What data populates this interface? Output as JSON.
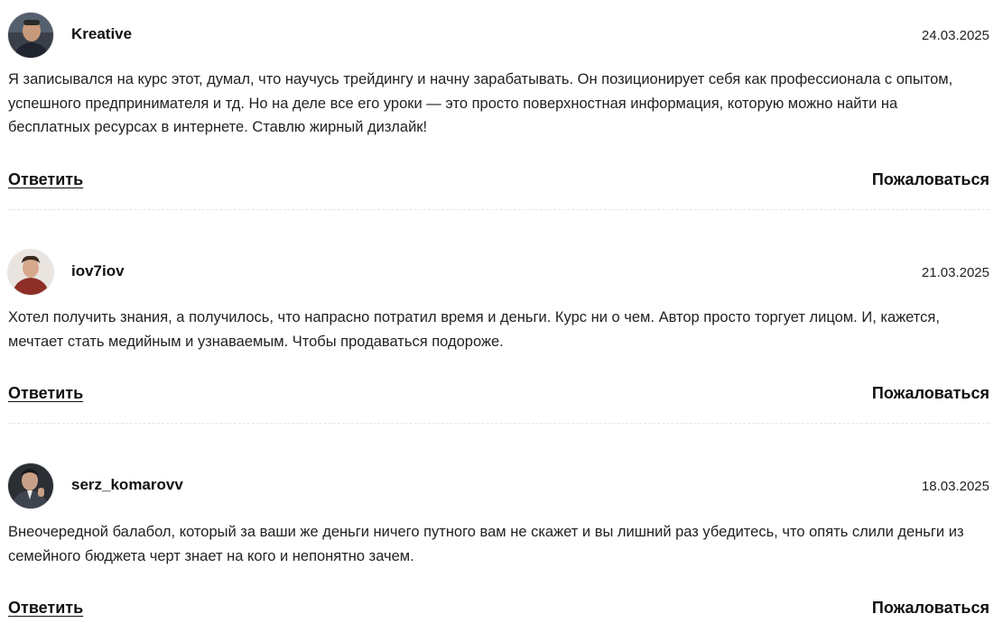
{
  "comments": [
    {
      "author": "Kreative",
      "date": "24.03.2025",
      "avatar_icon": "user-avatar-icon",
      "text": "Я записывался на курс этот, думал, что научусь трейдингу и начну зарабатывать. Он позиционирует себя как профессионала с опытом, успешного предпринимателя и тд. Но на деле все его уроки — это просто поверхностная информация, которую можно найти на бесплатных ресурсах в интернете. Ставлю жирный дизлайк!",
      "reply_label": "Ответить",
      "report_label": "Пожаловаться"
    },
    {
      "author": "iov7iov",
      "date": "21.03.2025",
      "avatar_icon": "user-avatar-icon",
      "text": "Хотел получить знания, а получилось, что напрасно потратил время и деньги. Курс ни о чем. Автор просто торгует лицом. И, кажется, мечтает стать медийным и узнаваемым. Чтобы продаваться подороже.",
      "reply_label": "Ответить",
      "report_label": "Пожаловаться"
    },
    {
      "author": "serz_komarovv",
      "date": "18.03.2025",
      "avatar_icon": "user-avatar-icon",
      "text": "Внеочередной балабол, который за ваши же деньги ничего путного вам не скажет и вы лишний раз убедитесь, что опять слили деньги из семейного бюджета черт знает на кого и непонятно зачем.",
      "reply_label": "Ответить",
      "report_label": "Пожаловаться"
    }
  ],
  "colors": {
    "text": "#222222",
    "divider": "#e4e4e4",
    "background": "#ffffff"
  }
}
